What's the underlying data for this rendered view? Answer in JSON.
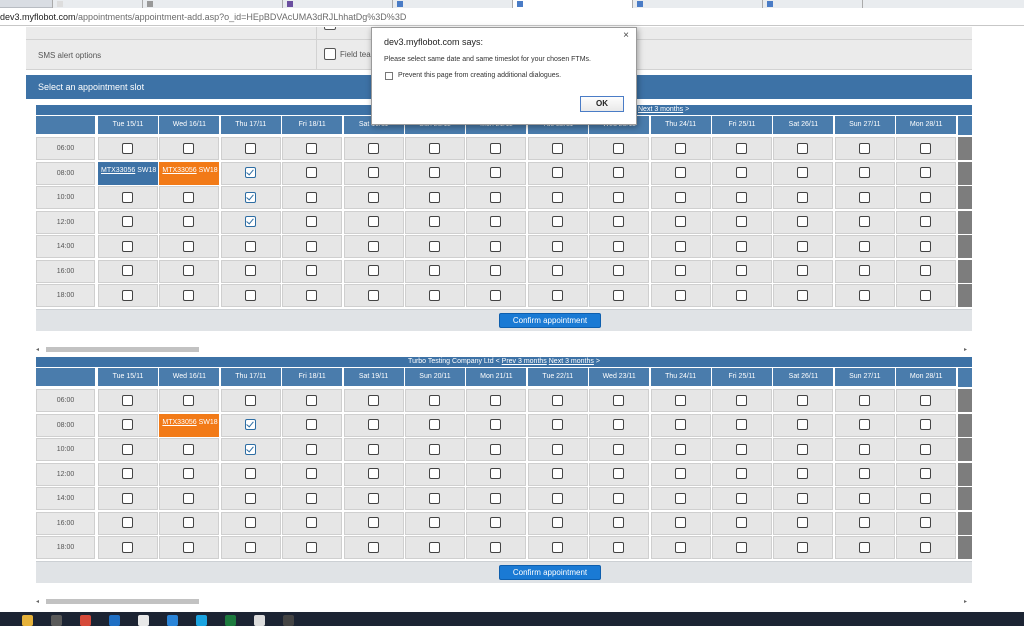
{
  "browser": {
    "url_host": "dev3.myflobot.com",
    "url_path": "/appointments/appointment-add.asp?o_id=HEpBDVAcUMA3dRJLhhatDg%3D%3D"
  },
  "form": {
    "sms_label": "SMS alert options",
    "field_team_label": "Field tea"
  },
  "slot_header": "Select an appointment slot",
  "calendars": [
    {
      "company": "",
      "prev_label": "",
      "next_label": "Next 3 months",
      "days": [
        "Tue 15/11",
        "Wed 16/11",
        "Thu 17/11",
        "Fri 18/11",
        "Sat 19/11",
        "Sun 20/11",
        "Mon 21/11",
        "Tue 22/11",
        "Wed 23/11",
        "Thu 24/11",
        "Fri 25/11",
        "Sat 26/11",
        "Sun 27/11",
        "Mon 28/11"
      ],
      "times": [
        "06:00",
        "08:00",
        "10:00",
        "12:00",
        "14:00",
        "16:00",
        "18:00"
      ],
      "checked": [
        [
          1,
          2
        ],
        [
          2,
          2
        ],
        [
          3,
          2
        ]
      ],
      "appointments": [
        {
          "row": 1,
          "col": 0,
          "color": "blue",
          "ref": "MTX33056",
          "postcode": "SW18"
        },
        {
          "row": 1,
          "col": 1,
          "color": "orange",
          "ref": "MTX33056",
          "postcode": "SW18"
        }
      ],
      "confirm_label": "Confirm appointment"
    },
    {
      "company": "Turbo Testing Company Ltd",
      "prev_label": "Prev 3 months",
      "next_label": "Next 3 months",
      "days": [
        "Tue 15/11",
        "Wed 16/11",
        "Thu 17/11",
        "Fri 18/11",
        "Sat 19/11",
        "Sun 20/11",
        "Mon 21/11",
        "Tue 22/11",
        "Wed 23/11",
        "Thu 24/11",
        "Fri 25/11",
        "Sat 26/11",
        "Sun 27/11",
        "Mon 28/11"
      ],
      "times": [
        "06:00",
        "08:00",
        "10:00",
        "12:00",
        "14:00",
        "16:00",
        "18:00"
      ],
      "checked": [
        [
          1,
          2
        ],
        [
          2,
          2
        ]
      ],
      "appointments": [
        {
          "row": 1,
          "col": 1,
          "color": "orange",
          "ref": "MTX33056",
          "postcode": "SW18"
        }
      ],
      "confirm_label": "Confirm appointment"
    }
  ],
  "dialog": {
    "title": "dev3.myflobot.com says:",
    "message": "Please select same date and same timeslot for your chosen FTMs.",
    "checkbox_label": "Prevent this page from creating additional dialogues.",
    "ok_label": "OK",
    "close_glyph": "×"
  },
  "colors": {
    "header_blue": "#3d72a6",
    "appt_orange": "#f27a17",
    "confirm_blue": "#1a7ad4"
  },
  "taskbar_icons": [
    "file-explorer-icon",
    "store-icon",
    "chrome-icon",
    "outlook-icon",
    "document-icon",
    "ie-icon",
    "skype-icon",
    "excel-icon",
    "notepad-icon",
    "photo-icon"
  ]
}
